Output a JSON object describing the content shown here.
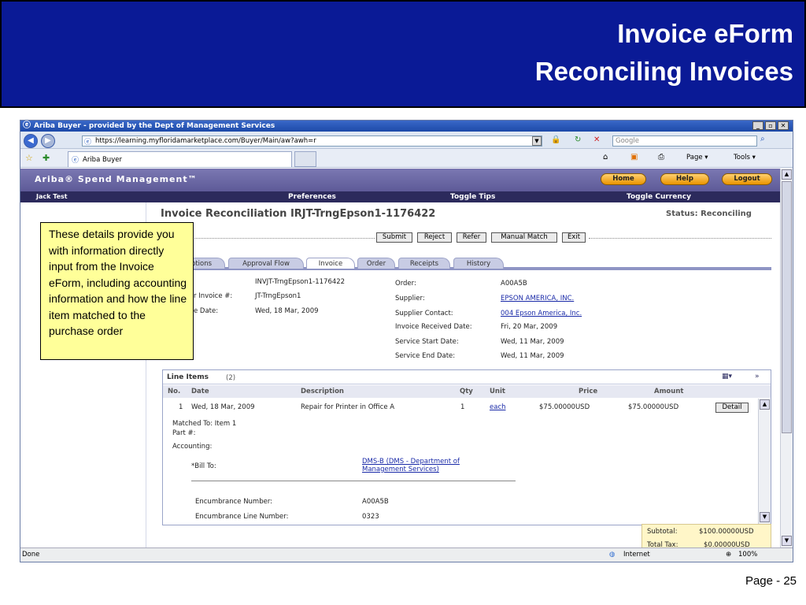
{
  "slide": {
    "title_line1": "Invoice eForm",
    "title_line2": "Reconciling Invoices",
    "page_number": "Page - 25",
    "callout_text": "These details provide you with information directly input from the Invoice eForm, including accounting information and how the line item matched to the purchase order"
  },
  "browser": {
    "window_title": "Ariba Buyer - provided by the Dept of Management Services",
    "address_url": "https://learning.myfloridamarketplace.com/Buyer/Main/aw?awh=r",
    "search_placeholder": "Google",
    "tab_label": "Ariba Buyer",
    "toolbar": {
      "page_label": "Page ▾",
      "tools_label": "Tools ▾"
    },
    "status": {
      "left": "Done",
      "zone": "Internet",
      "zoom": "100%"
    }
  },
  "ariba": {
    "brand": "Ariba® Spend Management™",
    "buttons": {
      "home": "Home",
      "help": "Help",
      "logout": "Logout"
    },
    "nav": {
      "user": "Jack Test",
      "preferences": "Preferences",
      "toggle_tips": "Toggle Tips",
      "toggle_currency": "Toggle Currency"
    }
  },
  "invoice": {
    "heading": "Invoice Reconciliation IRJT-TrngEpson1-1176422",
    "status": "Status: Reconciling",
    "actions": [
      "Submit",
      "Reject",
      "Refer",
      "Manual Match",
      "Exit"
    ],
    "tabs": [
      "ptions",
      "Approval Flow",
      "Invoice",
      "Order",
      "Receipts",
      "History"
    ],
    "active_tab": "Invoice",
    "left_fields": [
      {
        "label": "",
        "value": "INVJT-TrngEpson1-1176422"
      },
      {
        "label": "r Invoice #:",
        "value": "JT-TrngEpson1"
      },
      {
        "label": "e Date:",
        "value": "Wed, 18 Mar, 2009"
      }
    ],
    "right_fields": [
      {
        "label": "Order:",
        "value": "A00A5B",
        "link": false
      },
      {
        "label": "Supplier:",
        "value": "EPSON AMERICA, INC.",
        "link": true
      },
      {
        "label": "Supplier Contact:",
        "value": "004 Epson America, Inc.",
        "link": true
      },
      {
        "label": "Invoice Received Date:",
        "value": "Fri, 20 Mar, 2009",
        "link": false
      },
      {
        "label": "Service Start Date:",
        "value": "Wed, 11 Mar, 2009",
        "link": false
      },
      {
        "label": "Service End Date:",
        "value": "Wed, 11 Mar, 2009",
        "link": false
      }
    ],
    "line_items": {
      "title": "Line Items",
      "count": "(2)",
      "columns": [
        "No.",
        "Date",
        "Description",
        "Qty",
        "Unit",
        "Price",
        "Amount"
      ],
      "row": {
        "no": "1",
        "date": "Wed, 18 Mar, 2009",
        "description": "Repair for Printer in Office A",
        "qty": "1",
        "unit": "each",
        "price": "$75.00000USD",
        "amount": "$75.00000USD",
        "detail_button": "Detail"
      },
      "matched_to": "Matched To:  Item 1",
      "part": "Part #:",
      "accounting": "Accounting:",
      "bill_to_label": "*Bill To:",
      "bill_to_value_line1": "DMS-B (DMS - Department of",
      "bill_to_value_line2": "Management Services)",
      "encumbrance_label": "Encumbrance Number:",
      "encumbrance_value": "A00A5B",
      "encumbrance_line_label": "Encumbrance Line Number:",
      "encumbrance_line_value": "0323"
    },
    "summary": {
      "subtotal_label": "Subtotal:",
      "subtotal_value": "$100.00000USD",
      "tax_label": "Total Tax:",
      "tax_value": "$0.00000USD"
    }
  }
}
